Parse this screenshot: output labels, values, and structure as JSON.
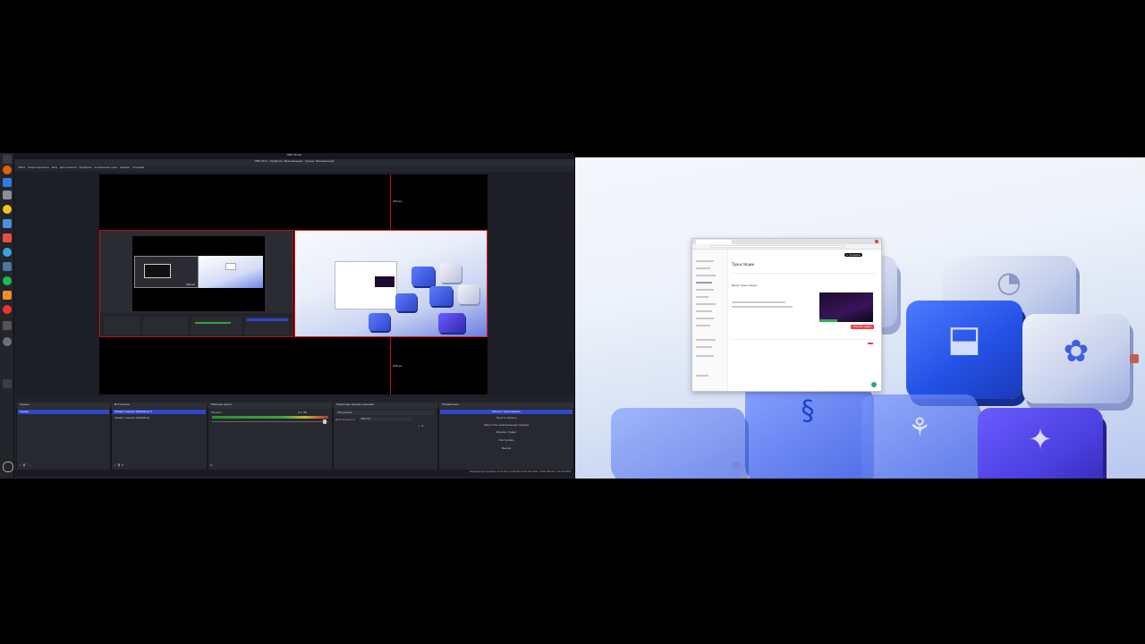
{
  "left_monitor": {
    "topbar": {
      "text": "OBS Studio"
    },
    "obs": {
      "title": "OBS 30.0 - Профиль: Безымянный - Сцены: Безымянный",
      "menu": [
        "Файл",
        "Редактировать",
        "Вид",
        "Док-панели",
        "Профиль",
        "Коллекция сцен",
        "Сервис",
        "Справка"
      ],
      "guide_top_label": "254 px",
      "guide_center_label": "484 px",
      "guide_bottom_label": "256 px",
      "source_toolbar": [
        "Свойства",
        "Фильтры"
      ],
      "docks": {
        "scenes": {
          "title": "Сцены",
          "items": [
            "Сцена"
          ]
        },
        "sources": {
          "title": "Источники",
          "items": [
            "Захват экрана (PipeWire) 2",
            "Захват экрана (PipeWire)"
          ]
        },
        "mixer": {
          "title": "Микшер звука",
          "track": "Mic/Aux",
          "level": "0.0 dB"
        },
        "transitions": {
          "title": "Переходы между сценами",
          "type": "Затухание",
          "duration_label": "Длительность",
          "duration": "300 ms"
        },
        "controls": {
          "title": "Управление",
          "buttons": [
            "Начать трансляцию",
            "Начать запись",
            "Запустить виртуальную камеру",
            "Режим студии",
            "Настройки",
            "Выход"
          ]
        }
      },
      "status": "Кадров пропущено 0 (0.0%)   0:00:00   0:00:00   CPU: 3.8%   60.00 / 60.00 FPS"
    }
  },
  "right_monitor": {
    "browser": {
      "site_title": "Трансляции",
      "button_label": "+ Создать",
      "section_label": "Ваши трансляции",
      "red_button": "Начать эфир"
    }
  },
  "colors": {
    "obs_bg": "#1e1f26",
    "selection": "#2f47c9",
    "guide_red": "#c0101a",
    "accent_blue": "#2452e6"
  }
}
